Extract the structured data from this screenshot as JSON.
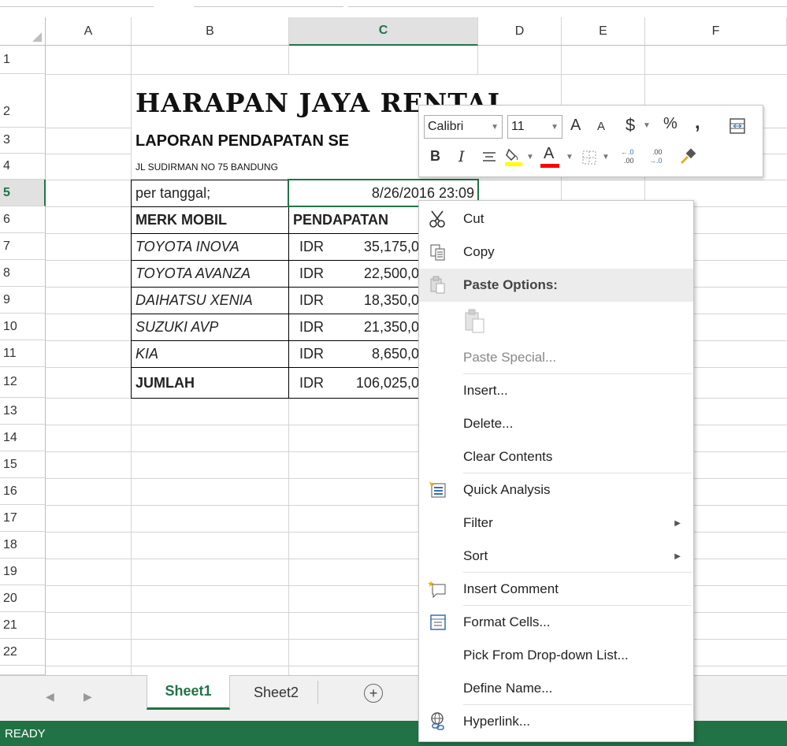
{
  "columns": [
    "A",
    "B",
    "C",
    "D",
    "E",
    "F"
  ],
  "selected_column": "C",
  "rows": [
    "1",
    "2",
    "3",
    "4",
    "5",
    "6",
    "7",
    "8",
    "9",
    "10",
    "11",
    "12",
    "13",
    "14",
    "15",
    "16",
    "17",
    "18",
    "19",
    "20",
    "21",
    "22"
  ],
  "selected_row": "5",
  "sheet": {
    "title": "HARAPAN JAYA RENTAL",
    "subtitle": "LAPORAN PENDAPATAN SE",
    "address": "JL SUDIRMAN NO 75 BANDUNG",
    "per_label": "per tanggal;",
    "date_value": "8/26/2016 23:09",
    "header_brand": "MERK MOBIL",
    "header_income": "PENDAPATAN",
    "rows": [
      {
        "brand": "TOYOTA INOVA",
        "cur": "IDR",
        "amount": "35,175,0"
      },
      {
        "brand": "TOYOTA AVANZA",
        "cur": "IDR",
        "amount": "22,500,0"
      },
      {
        "brand": "DAIHATSU XENIA",
        "cur": "IDR",
        "amount": "18,350,0"
      },
      {
        "brand": "SUZUKI AVP",
        "cur": "IDR",
        "amount": "21,350,0"
      },
      {
        "brand": "KIA",
        "cur": "IDR",
        "amount": "8,650,0"
      }
    ],
    "total_label": "JUMLAH",
    "total_cur": "IDR",
    "total_amount": "106,025,0"
  },
  "mini_toolbar": {
    "font": "Calibri",
    "size": "11",
    "grow": "A",
    "shrink": "A",
    "currency": "$",
    "percent": "%",
    "comma": ",",
    "bold": "B",
    "italic": "I",
    "font_color_letter": "A",
    "inc_decimal": "←.0 .00",
    "dec_decimal": ".00 →.0",
    "fill_color": "#ffff00",
    "font_color": "#ff0000"
  },
  "context_menu": {
    "cut": "Cut",
    "copy": "Copy",
    "paste_options": "Paste Options:",
    "paste_special": "Paste Special...",
    "insert": "Insert...",
    "delete": "Delete...",
    "clear_contents": "Clear Contents",
    "quick_analysis": "Quick Analysis",
    "filter": "Filter",
    "sort": "Sort",
    "insert_comment": "Insert Comment",
    "format_cells": "Format Cells...",
    "pick_list": "Pick From Drop-down List...",
    "define_name": "Define Name...",
    "hyperlink": "Hyperlink..."
  },
  "tabs": {
    "sheet1": "Sheet1",
    "sheet2": "Sheet2",
    "add": "+"
  },
  "status": "READY",
  "colors": {
    "excel_green": "#217346",
    "grid": "#d4d4d4"
  }
}
